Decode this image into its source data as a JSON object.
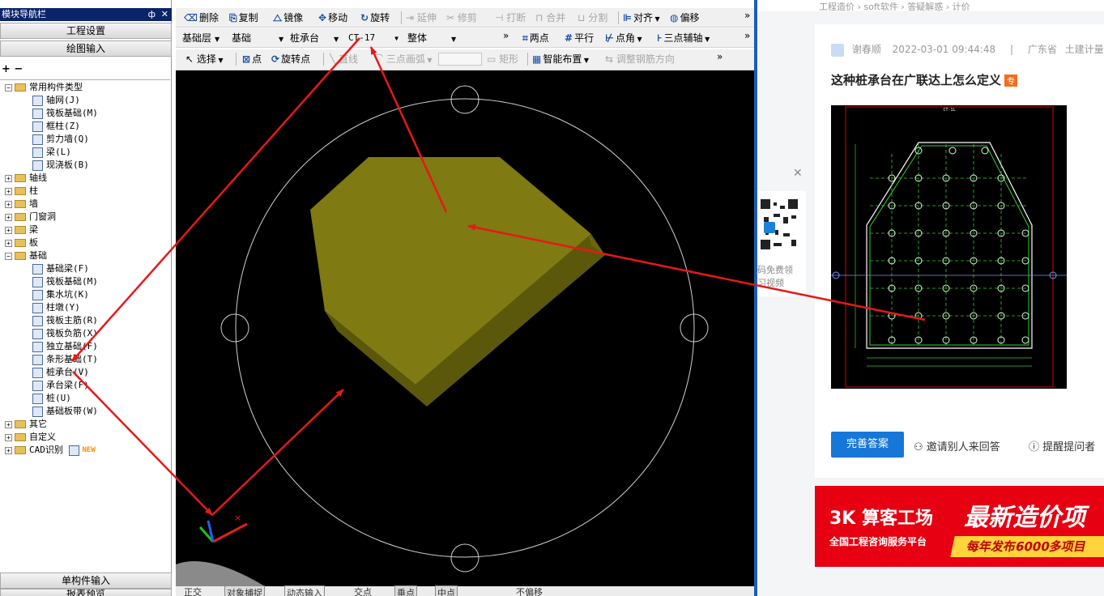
{
  "nav": {
    "title": "模块导航栏",
    "pin": "ф",
    "close": "✕",
    "project_settings": "工程设置",
    "drawing_input": "绘图输入",
    "single_input": "单构件输入",
    "report_preview": "报表预览",
    "tree_tools": "+ −",
    "tree": {
      "common": {
        "label": "常用构件类型",
        "expander": "−",
        "items": [
          "轴网(J)",
          "筏板基础(M)",
          "框柱(Z)",
          "剪力墙(Q)",
          "梁(L)",
          "现浇板(B)"
        ]
      },
      "groups_a": [
        {
          "label": "轴线",
          "expander": "+"
        },
        {
          "label": "柱",
          "expander": "+"
        },
        {
          "label": "墙",
          "expander": "+"
        },
        {
          "label": "门窗洞",
          "expander": "+"
        },
        {
          "label": "梁",
          "expander": "+"
        },
        {
          "label": "板",
          "expander": "+"
        }
      ],
      "foundation": {
        "label": "基础",
        "expander": "−",
        "items": [
          "基础梁(F)",
          "筏板基础(M)",
          "集水坑(K)",
          "柱墩(Y)",
          "筏板主筋(R)",
          "筏板负筋(X)",
          "独立基础(F)",
          "条形基础(T)",
          "桩承台(V)",
          "承台梁(F)",
          "桩(U)",
          "基础板带(W)"
        ]
      },
      "groups_b": [
        {
          "label": "其它",
          "expander": "+"
        },
        {
          "label": "自定义",
          "expander": "+"
        },
        {
          "label": "CAD识别",
          "expander": "+",
          "badge": "NEW"
        }
      ]
    }
  },
  "toolbar1": {
    "delete": "删除",
    "copy": "复制",
    "mirror": "镜像",
    "move": "移动",
    "rotate": "旋转",
    "extend": "延伸",
    "trim": "修剪",
    "break": "打断",
    "merge": "合并",
    "split": "分割",
    "align": "对齐",
    "offset": "偏移",
    "more": "»"
  },
  "toolbar2": {
    "layer": "基础层",
    "category": "基础",
    "type": "桩承台",
    "element": "CT-17",
    "mode": "整体",
    "more1": "»",
    "two_points": "两点",
    "parallel": "平行",
    "point_angle": "点角",
    "three_point_aux": "三点辅轴",
    "more2": "»"
  },
  "toolbar3": {
    "select": "选择",
    "point": "点",
    "rotate_point": "旋转点",
    "line": "直线",
    "arc": "三点画弧",
    "rect": "矩形",
    "smart_layout": "智能布置",
    "adjust_rebar": "调整钢筋方向",
    "more": "»"
  },
  "status": {
    "items": [
      "正交",
      "对象捕捉",
      "动态输入",
      "交点",
      "垂点",
      "中点",
      "不偏移"
    ]
  },
  "web": {
    "breadcrumb": "工程造价 › soft软件 › 答疑解惑 › 计价",
    "author": "谢春顺",
    "datetime": "2022-03-01 09:44:48",
    "divider": "|",
    "location": "广东省",
    "subject": "土建计量GTJ",
    "question": "这种桩承台在广联达上怎么定义",
    "tag": "专",
    "drawing_title": "CT-1L",
    "answer_btn": "完善答案",
    "invite": "邀请别人来回答",
    "remind": "提醒提问者",
    "qr_text_1": "码免费领",
    "qr_text_2": "习视频",
    "qr_close": "✕",
    "ad": {
      "logo": "3K 算客工场",
      "sub": "全国工程咨询服务平台",
      "big": "最新造价项",
      "band": "每年发布6000多项目"
    }
  }
}
